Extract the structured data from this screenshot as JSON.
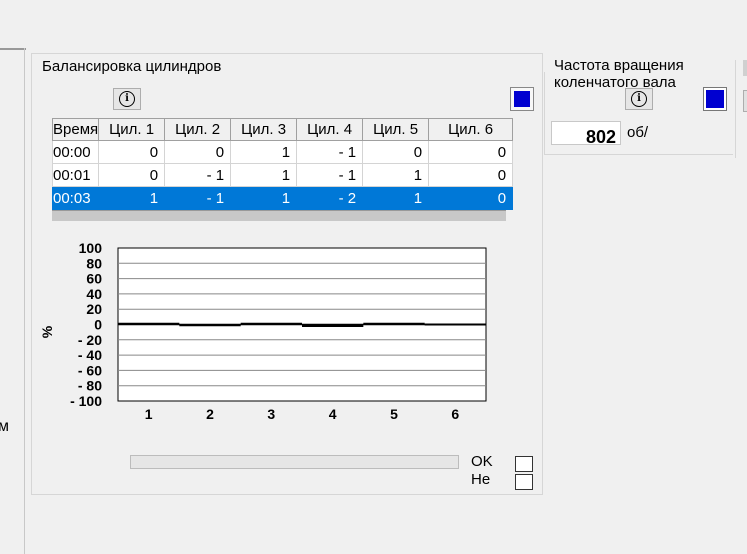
{
  "left_panel": {
    "cut_text": "м"
  },
  "balance": {
    "title": "Балансировка цилиндров",
    "table": {
      "columns": [
        "Время",
        "Цил. 1",
        "Цил. 2",
        "Цил. 3",
        "Цил. 4",
        "Цил. 5",
        "Цил. 6"
      ],
      "rows": [
        [
          "00:00",
          "0",
          "0",
          "1",
          "- 1",
          "0",
          "0"
        ],
        [
          "00:01",
          "0",
          "- 1",
          "1",
          "- 1",
          "1",
          "0"
        ],
        [
          "00:03",
          "1",
          "- 1",
          "1",
          "- 2",
          "1",
          "0"
        ]
      ],
      "selected_row": 2
    },
    "ok_label": "OK",
    "not_label": "Не"
  },
  "chart_data": {
    "type": "line",
    "categories": [
      "1",
      "2",
      "3",
      "4",
      "5",
      "6"
    ],
    "ylabel": "%",
    "ylim": [
      -100,
      100
    ],
    "yticks": [
      "100",
      "80",
      "60",
      "40",
      "20",
      "0",
      "- 20",
      "- 40",
      "- 60",
      "- 80",
      "- 100"
    ],
    "grid": true,
    "series": [
      {
        "values": [
          1,
          -1,
          1,
          -2,
          1,
          0
        ]
      }
    ]
  },
  "rpm": {
    "title_line1": "Частота вращения",
    "title_line2": "коленчатого вала",
    "value": "802",
    "unit": "об/"
  },
  "colors": {
    "indicator": "#0000d0",
    "selection": "#0078d7"
  }
}
